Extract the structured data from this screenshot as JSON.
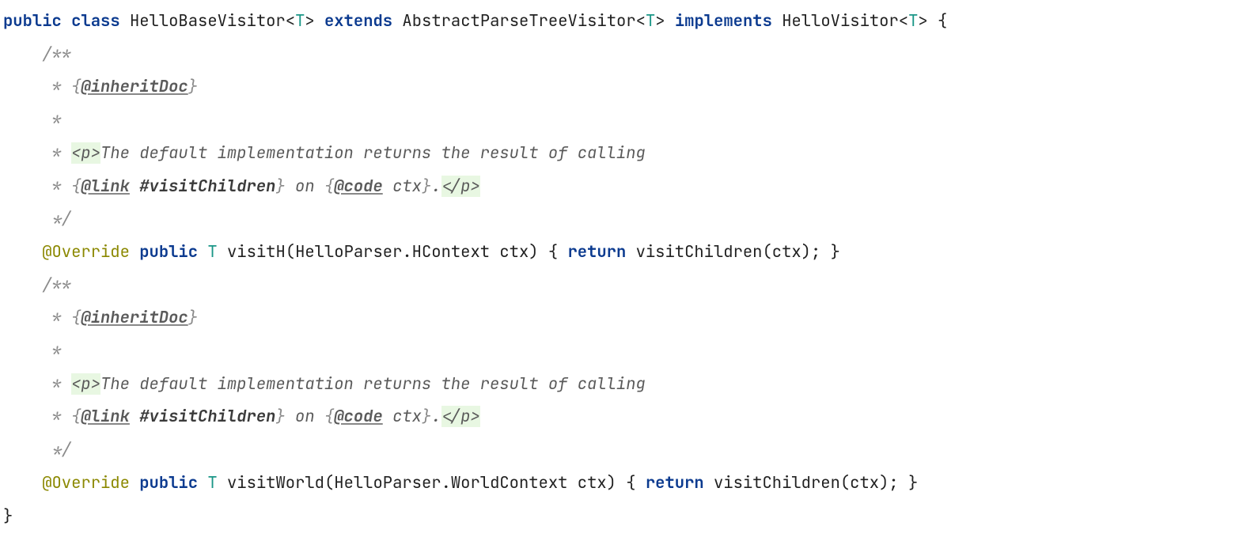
{
  "line1": {
    "kw_public": "public",
    "kw_class": "class",
    "class_name": "HelloBaseVisitor",
    "lt1": "<",
    "t1": "T",
    "gt1": ">",
    "kw_extends": "extends",
    "super_name": "AbstractParseTreeVisitor",
    "lt2": "<",
    "t2": "T",
    "gt2": ">",
    "kw_implements": "implements",
    "iface": "HelloVisitor",
    "lt3": "<",
    "t3": "T",
    "gt3": ">",
    "brace": " {"
  },
  "doc": {
    "open": "/**",
    "star": " *",
    "inherit_l": " * {",
    "inherit_tag": "@inheritDoc",
    "inherit_r": "}",
    "p_open_pre": " * ",
    "p_open": "<p>",
    "p_text": "The default implementation returns the result of calling",
    "link_l": " * {",
    "link_tag": "@link",
    "link_sp": " ",
    "link_target": "#visitChildren",
    "link_r": "}",
    "on": " on ",
    "code_l": "{",
    "code_tag": "@code",
    "code_sp": " ",
    "code_arg": "ctx",
    "code_r": "}",
    "dot": ".",
    "p_close": "</p>",
    "close": " */"
  },
  "method1": {
    "ann": "@Override",
    "kw_public": "public",
    "ret_type": "T",
    "sig": "visitH(HelloParser.HContext ctx) { ",
    "kw_return": "return",
    "body": " visitChildren(ctx); }"
  },
  "method2": {
    "ann": "@Override",
    "kw_public": "public",
    "ret_type": "T",
    "sig": "visitWorld(HelloParser.WorldContext ctx) { ",
    "kw_return": "return",
    "body": " visitChildren(ctx); }"
  },
  "end_brace": "}"
}
